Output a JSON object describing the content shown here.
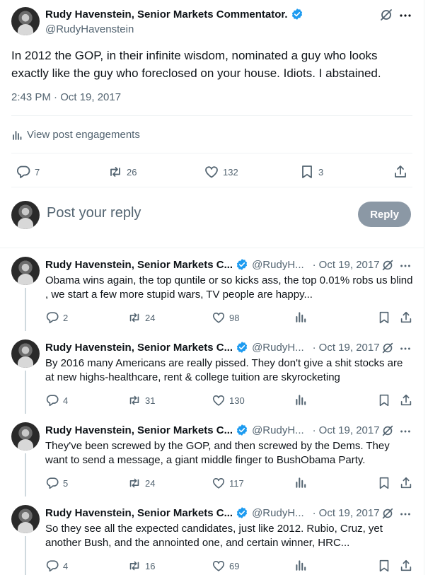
{
  "main_tweet": {
    "author_name": "Rudy Havenstein, Senior Markets Commentator.",
    "handle": "@RudyHavenstein",
    "text": "In 2012 the GOP, in their infinite wisdom, nominated a guy who looks exactly like the guy who foreclosed on your house. Idiots. I abstained.",
    "timestamp": "2:43 PM · Oct 19, 2017",
    "engagements_label": "View post engagements",
    "replies": "7",
    "reposts": "26",
    "likes": "132",
    "bookmarks": "3"
  },
  "reply_box": {
    "placeholder": "Post your reply",
    "button_label": "Reply"
  },
  "replies": [
    {
      "author_name": "Rudy Havenstein, Senior Markets C...",
      "handle": "@RudyH...",
      "separator": "·",
      "date": "Oct 19, 2017",
      "text": "Obama wins again, the top quntile or so kicks ass, the top 0.01% robs us blind , we start a few more stupid wars, TV people are happy...",
      "replies": "2",
      "reposts": "24",
      "likes": "98"
    },
    {
      "author_name": "Rudy Havenstein, Senior Markets C...",
      "handle": "@RudyH...",
      "separator": "·",
      "date": "Oct 19, 2017",
      "text": "By 2016 many Americans are really pissed. They don't give a shit stocks are at new highs-healthcare, rent & college tuition are skyrocketing",
      "replies": "4",
      "reposts": "31",
      "likes": "130"
    },
    {
      "author_name": "Rudy Havenstein, Senior Markets C...",
      "handle": "@RudyH...",
      "separator": "·",
      "date": "Oct 19, 2017",
      "text": "They've been screwed by the GOP, and then screwed by the Dems. They want to send a message, a giant middle finger to BushObama Party.",
      "replies": "5",
      "reposts": "24",
      "likes": "117"
    },
    {
      "author_name": "Rudy Havenstein, Senior Markets C...",
      "handle": "@RudyH...",
      "separator": "·",
      "date": "Oct 19, 2017",
      "text": "So they see all the expected candidates, just like 2012. Rubio, Cruz, yet another Bush, and the annointed one, and certain winner, HRC...",
      "replies": "4",
      "reposts": "16",
      "likes": "69"
    }
  ],
  "icons": {
    "verified": "verified-badge-icon",
    "grok": "grok-icon",
    "more": "more-icon",
    "reply": "reply-icon",
    "repost": "repost-icon",
    "like": "like-icon",
    "views": "views-icon",
    "bookmark": "bookmark-icon",
    "share": "share-icon"
  },
  "colors": {
    "text": "#0f1419",
    "secondary": "#536471",
    "verified": "#1d9bf0",
    "reply_button": "#8b98a5",
    "border": "#eff3f4"
  }
}
